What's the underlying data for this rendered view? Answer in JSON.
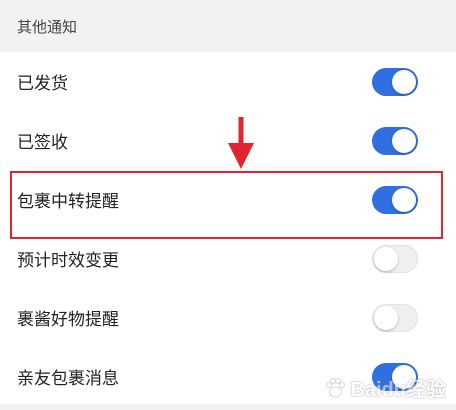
{
  "section": {
    "title": "其他通知"
  },
  "settings": [
    {
      "label": "已发货",
      "enabled": true
    },
    {
      "label": "已签收",
      "enabled": true
    },
    {
      "label": "包裹中转提醒",
      "enabled": true
    },
    {
      "label": "预计时效变更",
      "enabled": false
    },
    {
      "label": "裹酱好物提醒",
      "enabled": false
    },
    {
      "label": "亲友包裹消息",
      "enabled": true
    }
  ],
  "colors": {
    "toggle_on": "#2f6fe0",
    "toggle_off": "#efefef",
    "highlight": "#e0252f",
    "section_bg": "#f2f2f4"
  },
  "annotation": {
    "icon": "red-down-arrow-icon"
  },
  "watermark": {
    "text": "Baidu经验"
  }
}
